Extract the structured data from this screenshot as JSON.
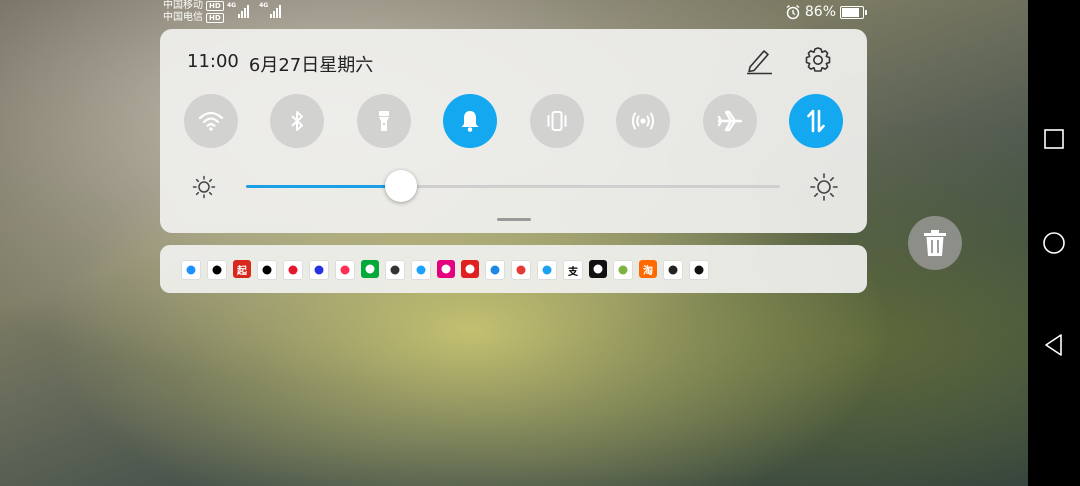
{
  "status_bar": {
    "carriers": [
      {
        "name": "中国移动",
        "badge": "HD"
      },
      {
        "name": "中国电信",
        "badge": "HD"
      }
    ],
    "signals": [
      {
        "network": "4G",
        "level": 4
      },
      {
        "network": "4G",
        "level": 4
      }
    ],
    "alarm_icon": "alarm-clock-icon",
    "battery_percent": "86%",
    "battery_level": 0.86
  },
  "quick_panel": {
    "time": "11:00",
    "date": "6月27日星期六",
    "edit_icon": "pencil-icon",
    "settings_icon": "gear-icon",
    "toggles": [
      {
        "icon": "wifi-icon",
        "active": false
      },
      {
        "icon": "bluetooth-icon",
        "active": false
      },
      {
        "icon": "flashlight-icon",
        "active": false
      },
      {
        "icon": "bell-icon",
        "active": true
      },
      {
        "icon": "vibrate-icon",
        "active": false
      },
      {
        "icon": "hotspot-icon",
        "active": false
      },
      {
        "icon": "airplane-icon",
        "active": false
      },
      {
        "icon": "mobile-data-icon",
        "active": true
      }
    ],
    "brightness": {
      "level": 0.29,
      "low_icon": "brightness-low-icon",
      "high_icon": "brightness-high-icon",
      "accent": "#1b9fe6"
    }
  },
  "notification_apps": [
    {
      "icon": "cloud-app-icon",
      "bg": "#ffffff",
      "fg": "#1e90ff",
      "glyph": ""
    },
    {
      "icon": "cloud-download-icon",
      "bg": "#ffffff",
      "fg": "#000000",
      "glyph": ""
    },
    {
      "icon": "qidian-icon",
      "bg": "#d8281e",
      "fg": "#ffffff",
      "glyph": "起"
    },
    {
      "icon": "wechat-icon",
      "bg": "#ffffff",
      "fg": "#000000",
      "glyph": ""
    },
    {
      "icon": "weibo-icon",
      "bg": "#ffffff",
      "fg": "#e6162d",
      "glyph": ""
    },
    {
      "icon": "baidu-icon",
      "bg": "#ffffff",
      "fg": "#2932e1",
      "glyph": ""
    },
    {
      "icon": "video-play-icon",
      "bg": "#ffffff",
      "fg": "#ff2d55",
      "glyph": ""
    },
    {
      "icon": "iqiyi-icon",
      "bg": "#00a93a",
      "fg": "#ffffff",
      "glyph": ""
    },
    {
      "icon": "globe-icon",
      "bg": "#ffffff",
      "fg": "#333333",
      "glyph": ""
    },
    {
      "icon": "youku-icon",
      "bg": "#ffffff",
      "fg": "#1aa3ff",
      "glyph": ""
    },
    {
      "icon": "pink-app-icon",
      "bg": "#e4007f",
      "fg": "#ffffff",
      "glyph": ""
    },
    {
      "icon": "netease-music-icon",
      "bg": "#e02020",
      "fg": "#ffffff",
      "glyph": ""
    },
    {
      "icon": "browser-icon",
      "bg": "#ffffff",
      "fg": "#1e88e5",
      "glyph": ""
    },
    {
      "icon": "red-book-icon",
      "bg": "#ffffff",
      "fg": "#e53935",
      "glyph": ""
    },
    {
      "icon": "send-icon",
      "bg": "#ffffff",
      "fg": "#1da1f2",
      "glyph": ""
    },
    {
      "icon": "alipay-icon",
      "bg": "#ffffff",
      "fg": "#000000",
      "glyph": "支"
    },
    {
      "icon": "black-app-icon",
      "bg": "#111111",
      "fg": "#ffffff",
      "glyph": ""
    },
    {
      "icon": "leaf-app-icon",
      "bg": "#ffffff",
      "fg": "#7cb342",
      "glyph": ""
    },
    {
      "icon": "taobao-icon",
      "bg": "#ff6a00",
      "fg": "#ffffff",
      "glyph": "淘"
    },
    {
      "icon": "hexagon-app-icon",
      "bg": "#ffffff",
      "fg": "#222222",
      "glyph": ""
    },
    {
      "icon": "chat-bubble-icon",
      "bg": "#ffffff",
      "fg": "#111111",
      "glyph": ""
    }
  ],
  "floating": {
    "trash_icon": "trash-icon"
  },
  "nav_bar": [
    {
      "icon": "recent-apps-icon"
    },
    {
      "icon": "home-icon"
    },
    {
      "icon": "back-icon"
    }
  ]
}
